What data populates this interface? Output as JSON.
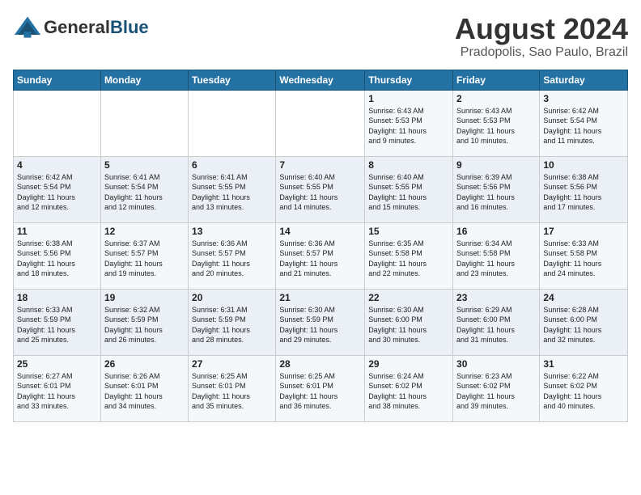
{
  "header": {
    "logo_general": "General",
    "logo_blue": "Blue",
    "month_year": "August 2024",
    "location": "Pradopolis, Sao Paulo, Brazil"
  },
  "days_of_week": [
    "Sunday",
    "Monday",
    "Tuesday",
    "Wednesday",
    "Thursday",
    "Friday",
    "Saturday"
  ],
  "weeks": [
    [
      {
        "day": "",
        "content": ""
      },
      {
        "day": "",
        "content": ""
      },
      {
        "day": "",
        "content": ""
      },
      {
        "day": "",
        "content": ""
      },
      {
        "day": "1",
        "content": "Sunrise: 6:43 AM\nSunset: 5:53 PM\nDaylight: 11 hours\nand 9 minutes."
      },
      {
        "day": "2",
        "content": "Sunrise: 6:43 AM\nSunset: 5:53 PM\nDaylight: 11 hours\nand 10 minutes."
      },
      {
        "day": "3",
        "content": "Sunrise: 6:42 AM\nSunset: 5:54 PM\nDaylight: 11 hours\nand 11 minutes."
      }
    ],
    [
      {
        "day": "4",
        "content": "Sunrise: 6:42 AM\nSunset: 5:54 PM\nDaylight: 11 hours\nand 12 minutes."
      },
      {
        "day": "5",
        "content": "Sunrise: 6:41 AM\nSunset: 5:54 PM\nDaylight: 11 hours\nand 12 minutes."
      },
      {
        "day": "6",
        "content": "Sunrise: 6:41 AM\nSunset: 5:55 PM\nDaylight: 11 hours\nand 13 minutes."
      },
      {
        "day": "7",
        "content": "Sunrise: 6:40 AM\nSunset: 5:55 PM\nDaylight: 11 hours\nand 14 minutes."
      },
      {
        "day": "8",
        "content": "Sunrise: 6:40 AM\nSunset: 5:55 PM\nDaylight: 11 hours\nand 15 minutes."
      },
      {
        "day": "9",
        "content": "Sunrise: 6:39 AM\nSunset: 5:56 PM\nDaylight: 11 hours\nand 16 minutes."
      },
      {
        "day": "10",
        "content": "Sunrise: 6:38 AM\nSunset: 5:56 PM\nDaylight: 11 hours\nand 17 minutes."
      }
    ],
    [
      {
        "day": "11",
        "content": "Sunrise: 6:38 AM\nSunset: 5:56 PM\nDaylight: 11 hours\nand 18 minutes."
      },
      {
        "day": "12",
        "content": "Sunrise: 6:37 AM\nSunset: 5:57 PM\nDaylight: 11 hours\nand 19 minutes."
      },
      {
        "day": "13",
        "content": "Sunrise: 6:36 AM\nSunset: 5:57 PM\nDaylight: 11 hours\nand 20 minutes."
      },
      {
        "day": "14",
        "content": "Sunrise: 6:36 AM\nSunset: 5:57 PM\nDaylight: 11 hours\nand 21 minutes."
      },
      {
        "day": "15",
        "content": "Sunrise: 6:35 AM\nSunset: 5:58 PM\nDaylight: 11 hours\nand 22 minutes."
      },
      {
        "day": "16",
        "content": "Sunrise: 6:34 AM\nSunset: 5:58 PM\nDaylight: 11 hours\nand 23 minutes."
      },
      {
        "day": "17",
        "content": "Sunrise: 6:33 AM\nSunset: 5:58 PM\nDaylight: 11 hours\nand 24 minutes."
      }
    ],
    [
      {
        "day": "18",
        "content": "Sunrise: 6:33 AM\nSunset: 5:59 PM\nDaylight: 11 hours\nand 25 minutes."
      },
      {
        "day": "19",
        "content": "Sunrise: 6:32 AM\nSunset: 5:59 PM\nDaylight: 11 hours\nand 26 minutes."
      },
      {
        "day": "20",
        "content": "Sunrise: 6:31 AM\nSunset: 5:59 PM\nDaylight: 11 hours\nand 28 minutes."
      },
      {
        "day": "21",
        "content": "Sunrise: 6:30 AM\nSunset: 5:59 PM\nDaylight: 11 hours\nand 29 minutes."
      },
      {
        "day": "22",
        "content": "Sunrise: 6:30 AM\nSunset: 6:00 PM\nDaylight: 11 hours\nand 30 minutes."
      },
      {
        "day": "23",
        "content": "Sunrise: 6:29 AM\nSunset: 6:00 PM\nDaylight: 11 hours\nand 31 minutes."
      },
      {
        "day": "24",
        "content": "Sunrise: 6:28 AM\nSunset: 6:00 PM\nDaylight: 11 hours\nand 32 minutes."
      }
    ],
    [
      {
        "day": "25",
        "content": "Sunrise: 6:27 AM\nSunset: 6:01 PM\nDaylight: 11 hours\nand 33 minutes."
      },
      {
        "day": "26",
        "content": "Sunrise: 6:26 AM\nSunset: 6:01 PM\nDaylight: 11 hours\nand 34 minutes."
      },
      {
        "day": "27",
        "content": "Sunrise: 6:25 AM\nSunset: 6:01 PM\nDaylight: 11 hours\nand 35 minutes."
      },
      {
        "day": "28",
        "content": "Sunrise: 6:25 AM\nSunset: 6:01 PM\nDaylight: 11 hours\nand 36 minutes."
      },
      {
        "day": "29",
        "content": "Sunrise: 6:24 AM\nSunset: 6:02 PM\nDaylight: 11 hours\nand 38 minutes."
      },
      {
        "day": "30",
        "content": "Sunrise: 6:23 AM\nSunset: 6:02 PM\nDaylight: 11 hours\nand 39 minutes."
      },
      {
        "day": "31",
        "content": "Sunrise: 6:22 AM\nSunset: 6:02 PM\nDaylight: 11 hours\nand 40 minutes."
      }
    ]
  ]
}
